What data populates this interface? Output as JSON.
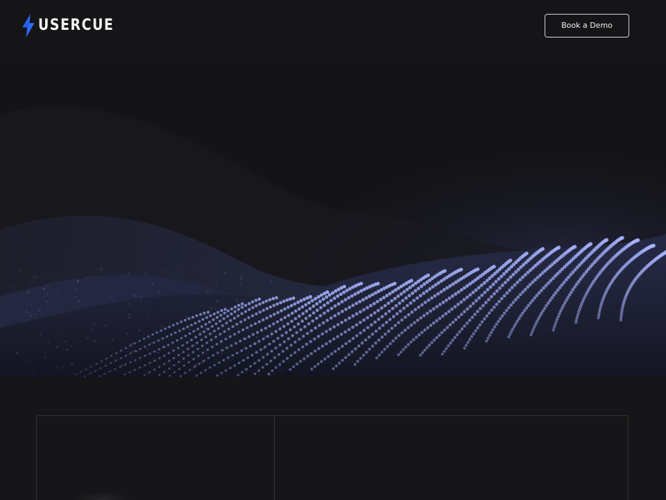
{
  "header": {
    "logo_text": "USERCUE",
    "logo_icon": "lightning-bolt-icon",
    "demo_button_label": "Book a Demo"
  },
  "hero": {
    "background_image": "dotted-particle-wave"
  },
  "colors": {
    "background": "#151517",
    "accent_blue": "#2d6cff",
    "particle": "#a8b4ff",
    "card_border": "#343438",
    "text": "#f4f4f6"
  }
}
